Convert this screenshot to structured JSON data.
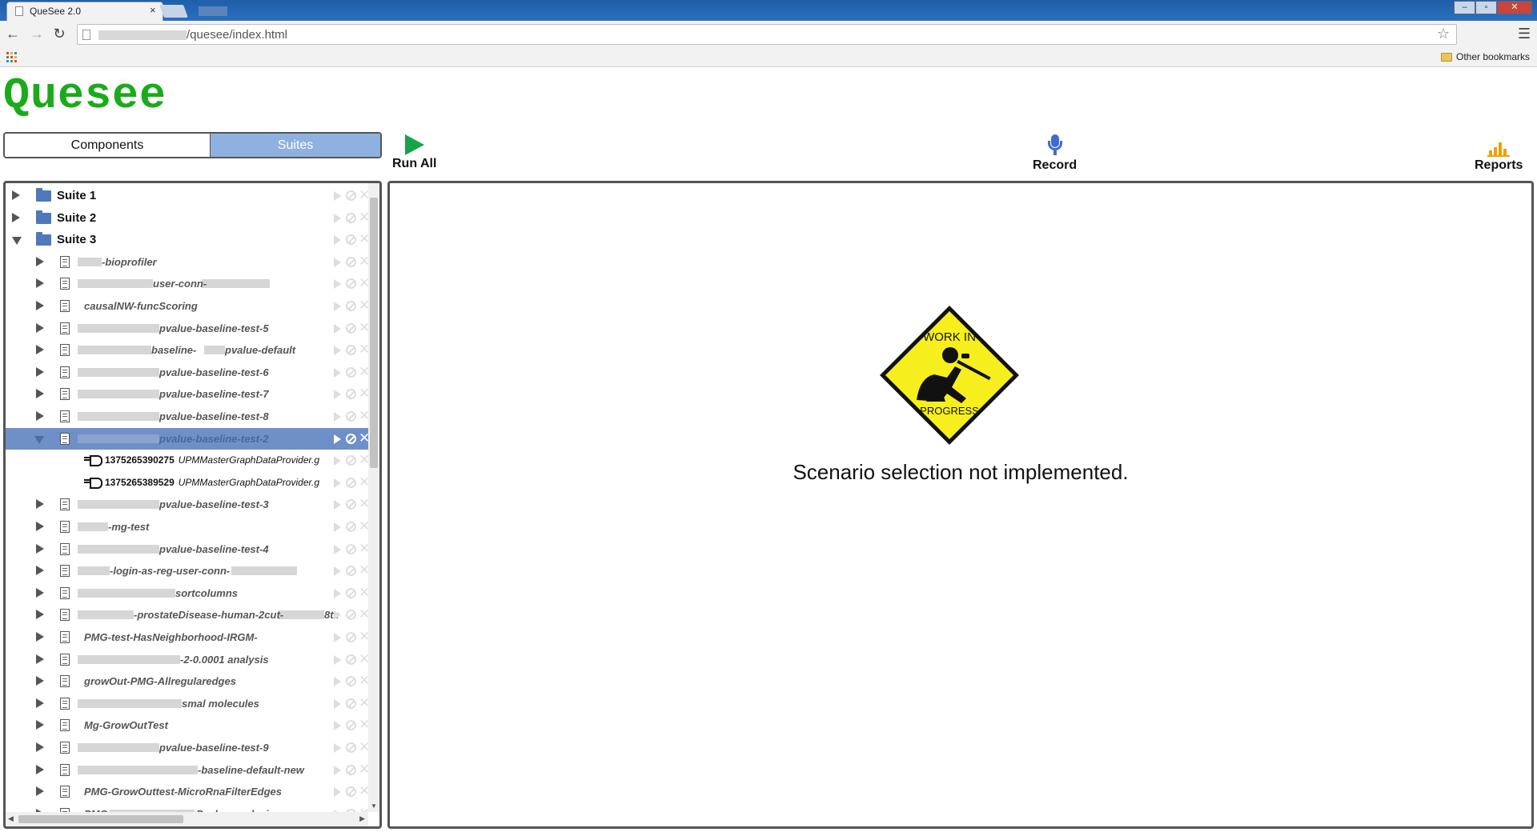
{
  "browser": {
    "tab_title": "QueSee 2.0",
    "tab_close": "×",
    "url": "/quesee/index.html",
    "other_bookmarks": "Other bookmarks",
    "window_buttons": [
      "–",
      "▫",
      "✕"
    ]
  },
  "app": {
    "logo": "Quesee",
    "tabs": {
      "components": "Components",
      "suites": "Suites",
      "active": "Suites"
    },
    "actions": {
      "run_all": "Run All",
      "record": "Record",
      "reports": "Reports"
    },
    "message": "Scenario selection not implemented.",
    "wip_sign": {
      "line1": "WORK IN",
      "line2": "PROGRESS"
    },
    "colors": {
      "logo": "#1aab1a",
      "selected_row": "#6f8fc7",
      "run": "#1aa24a",
      "record": "#3f6bd0",
      "reports": "#f0a000"
    }
  },
  "tree": {
    "suites": [
      {
        "label": "Suite 1",
        "expanded": false
      },
      {
        "label": "Suite 2",
        "expanded": false
      },
      {
        "label": "Suite 3",
        "expanded": true
      }
    ],
    "tests": [
      "-bioprofiler",
      "user-conn-",
      "causalNW-funcScoring",
      "pvalue-baseline-test-5",
      "baseline-",
      "pvalue-baseline-test-6",
      "pvalue-baseline-test-7",
      "pvalue-baseline-test-8",
      "pvalue-baseline-test-2",
      "pvalue-baseline-test-3",
      "-mg-test",
      "pvalue-baseline-test-4",
      "-login-as-reg-user-conn-",
      "sortcolumns",
      "-prostateDisease-human-2cut-",
      "PMG-test-HasNeighborhood-IRGM-",
      "-2-0.0001 analysis",
      "growOut-PMG-Allregularedges",
      "smal molecules",
      "Mg-GrowOutTest",
      "pvalue-baseline-test-9",
      "-baseline-default-new",
      "PMG-GrowOuttest-MicroRnaFilterEdges",
      "PMG-",
      "pvalue-default",
      "8tz",
      "Pvalue-analysis"
    ],
    "selected_test": "pvalue-baseline-test-2",
    "scenarios": [
      {
        "id": "1375265390275",
        "provider": "UPMMasterGraphDataProvider.g"
      },
      {
        "id": "1375265389529",
        "provider": "UPMMasterGraphDataProvider.g"
      }
    ]
  }
}
